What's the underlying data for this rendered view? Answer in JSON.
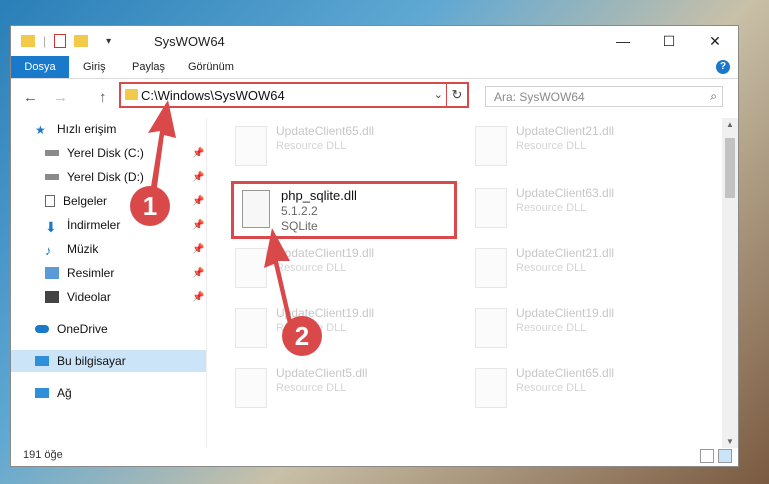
{
  "window": {
    "title": "SysWOW64"
  },
  "window_controls": {
    "minimize": "—",
    "maximize": "☐",
    "close": "✕"
  },
  "ribbon": {
    "file": "Dosya",
    "home": "Giriş",
    "share": "Paylaş",
    "view": "Görünüm",
    "help": "?"
  },
  "address": {
    "path": "C:\\Windows\\SysWOW64",
    "dropdown": "⌄",
    "refresh": "↻"
  },
  "search": {
    "placeholder": "Ara: SysWOW64",
    "icon": "⌕"
  },
  "nav": {
    "back": "←",
    "forward": "→",
    "up": "↑",
    "items": [
      {
        "label": "Hızlı erişim",
        "icon": "star-icon",
        "pinned": false
      },
      {
        "label": "Yerel Disk (C:)",
        "icon": "disk-icon",
        "pinned": true
      },
      {
        "label": "Yerel Disk (D:)",
        "icon": "disk-icon",
        "pinned": true
      },
      {
        "label": "Belgeler",
        "icon": "documents-icon",
        "pinned": true
      },
      {
        "label": "İndirmeler",
        "icon": "downloads-icon",
        "pinned": true
      },
      {
        "label": "Müzik",
        "icon": "music-icon",
        "pinned": true
      },
      {
        "label": "Resimler",
        "icon": "pictures-icon",
        "pinned": true
      },
      {
        "label": "Videolar",
        "icon": "videos-icon",
        "pinned": true
      },
      {
        "label": "OneDrive",
        "icon": "cloud-icon",
        "pinned": false
      },
      {
        "label": "Bu bilgisayar",
        "icon": "computer-icon",
        "pinned": false,
        "selected": true
      },
      {
        "label": "Ağ",
        "icon": "network-icon",
        "pinned": false
      }
    ],
    "pin_glyph": "📌"
  },
  "files": {
    "highlighted": {
      "name": "php_sqlite.dll",
      "version": "5.1.2.2",
      "description": "SQLite"
    },
    "faded": [
      {
        "name": "UpdateClient65.dll",
        "desc": "Resource DLL"
      },
      {
        "name": "UpdateClient21.dll",
        "desc": "Resource DLL"
      },
      {
        "name": "UpdateClient63.dll",
        "desc": "Resource DLL"
      },
      {
        "name": "UpdateClient19.dll",
        "desc": "Resource DLL"
      },
      {
        "name": "UpdateClient21.dll",
        "desc": "Resource DLL"
      },
      {
        "name": "UpdateClient19.dll",
        "desc": "Resource DLL"
      },
      {
        "name": "UpdateClient19.dll",
        "desc": "Resource DLL"
      },
      {
        "name": "UpdateClient5.dll",
        "desc": "Resource DLL"
      },
      {
        "name": "UpdateClient65.dll",
        "desc": "Resource DLL"
      }
    ]
  },
  "status": {
    "item_count": "191 öğe"
  },
  "annotations": {
    "step1": "1",
    "step2": "2",
    "color": "#d9494a"
  }
}
